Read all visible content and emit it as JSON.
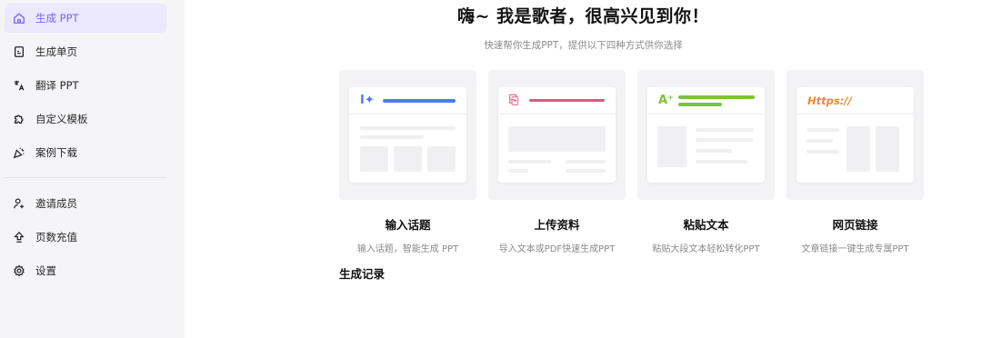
{
  "sidebar": {
    "items": [
      {
        "label": "生成 PPT",
        "icon": "home-icon"
      },
      {
        "label": "生成单页",
        "icon": "document-icon"
      },
      {
        "label": "翻译 PPT",
        "icon": "translate-icon"
      },
      {
        "label": "自定义模板",
        "icon": "puzzle-icon"
      },
      {
        "label": "案例下载",
        "icon": "party-popper-icon"
      }
    ],
    "bottom_items": [
      {
        "label": "邀请成员",
        "icon": "add-user-icon"
      },
      {
        "label": "页数充值",
        "icon": "upload-arrow-icon"
      },
      {
        "label": "设置",
        "icon": "gear-icon"
      }
    ]
  },
  "main": {
    "title": "嗨~ 我是歌者，很高兴见到你！",
    "subtitle": "快速帮你生成PPT，提供以下四种方式供你选择",
    "cards": [
      {
        "title": "输入话题",
        "desc": "输入话题，智能生成 PPT",
        "glyph": "I✦",
        "accent": "#4e7cf6"
      },
      {
        "title": "上传资料",
        "desc": "导入文本或PDF快速生成PPT",
        "glyph": "⎘",
        "accent": "#e8547a"
      },
      {
        "title": "粘贴文本",
        "desc": "粘贴大段文本轻松转化PPT",
        "glyph": "A⁺",
        "accent": "#7cc33a"
      },
      {
        "title": "网页链接",
        "desc": "文章链接一键生成专属PPT",
        "glyph": "Https://",
        "accent": "#f08a2b"
      }
    ],
    "records_title": "生成记录"
  },
  "colors": {
    "active": "#7b61ff",
    "active_bg": "#ebe9fb",
    "sidebar_bg": "#f5f5f7"
  }
}
